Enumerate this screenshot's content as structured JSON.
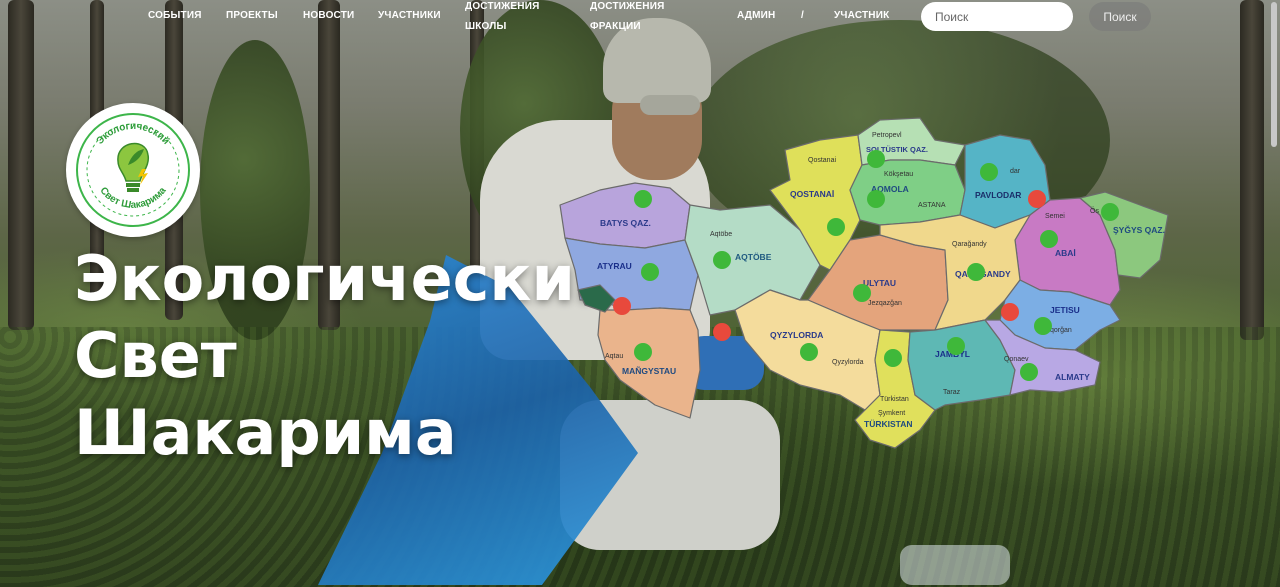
{
  "nav": {
    "items": [
      {
        "label": "События"
      },
      {
        "label": "Проекты"
      },
      {
        "label": "Новости"
      },
      {
        "label": "Участники"
      },
      {
        "label": "Достижения школы"
      },
      {
        "label": "Достижения фракции"
      },
      {
        "label": "Админ"
      },
      {
        "label": "/"
      },
      {
        "label": "Участник"
      }
    ],
    "search": {
      "placeholder": "Поиск",
      "button_label": "Поиск"
    }
  },
  "logo": {
    "text": "Экологический Свет Шакарима",
    "colors": {
      "ring": "#3db54a",
      "leaf": "#8cc63f",
      "accent": "#f2c300"
    }
  },
  "hero": {
    "title_lines": [
      "Экологический",
      "Свет",
      "Шакарима"
    ]
  },
  "map": {
    "regions": [
      {
        "name": "BATYS QAZ.",
        "color": "#b8a4dc"
      },
      {
        "name": "ATYRAU",
        "color": "#8fa8e0"
      },
      {
        "name": "AQTÖBE",
        "color": "#b4dcc6"
      },
      {
        "name": "MAÑGYSTAU",
        "color": "#eab48c"
      },
      {
        "name": "QOSTANAİ",
        "color": "#dfe05a"
      },
      {
        "name": "SOLTÜSTIK QAZ.",
        "color": "#b6e0b4"
      },
      {
        "name": "AQMOLA",
        "color": "#7fcf86"
      },
      {
        "name": "PAVLODAR",
        "color": "#55b4c6"
      },
      {
        "name": "ABAİ",
        "color": "#c87ac4"
      },
      {
        "name": "ŞYĞYS QAZ.",
        "color": "#8cc87e"
      },
      {
        "name": "ULYTAU",
        "color": "#e4a47c"
      },
      {
        "name": "QARAĞANDY",
        "color": "#f0d88c"
      },
      {
        "name": "QYZYLORDA",
        "color": "#f4dc9c"
      },
      {
        "name": "TÜRKISTAN",
        "color": "#e0e05c"
      },
      {
        "name": "JAMBYL",
        "color": "#5eb8b4"
      },
      {
        "name": "JETISU",
        "color": "#7caee4"
      },
      {
        "name": "ALMATY",
        "color": "#b8a8e4"
      }
    ],
    "cities": [
      "Petropevl",
      "Qostanai",
      "Kökşetau",
      "ASTANA",
      "dar",
      "Semei",
      "Ös",
      "Aqtöbe",
      "Qarağandy",
      "Jezqazğan",
      "Aqtau",
      "Qyzylorda",
      "Şymkent",
      "Taraz",
      "Qonaev",
      "qorğan",
      "Türkistan"
    ],
    "markers": {
      "green": 21,
      "red": 5,
      "colors": {
        "green": "#3fb83a",
        "red": "#e8493c"
      }
    }
  }
}
